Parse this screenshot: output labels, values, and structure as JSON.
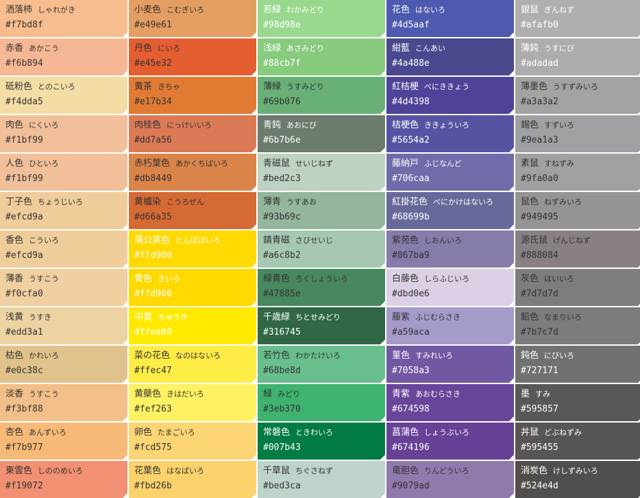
{
  "columns": [
    {
      "items": [
        {
          "name": "洒落柿",
          "reading": "しゃれがき",
          "hex": "#f7bd8f",
          "text": "#333333"
        },
        {
          "name": "赤香",
          "reading": "あかこう",
          "hex": "#f6b894",
          "text": "#333333"
        },
        {
          "name": "砥粉色",
          "reading": "とのこいろ",
          "hex": "#f4dda5",
          "text": "#333333"
        },
        {
          "name": "肉色",
          "reading": "にくいろ",
          "hex": "#f1bf99",
          "text": "#333333"
        },
        {
          "name": "人色",
          "reading": "ひといろ",
          "hex": "#f1bf99",
          "text": "#333333"
        },
        {
          "name": "丁子色",
          "reading": "ちょうじいろ",
          "hex": "#efcd9a",
          "text": "#333333"
        },
        {
          "name": "香色",
          "reading": "こういろ",
          "hex": "#efcd9a",
          "text": "#333333"
        },
        {
          "name": "薄香",
          "reading": "うすこう",
          "hex": "#f0cfa0",
          "text": "#333333"
        },
        {
          "name": "浅黄",
          "reading": "うすき",
          "hex": "#edd3a1",
          "text": "#333333"
        },
        {
          "name": "枯色",
          "reading": "かれいろ",
          "hex": "#e0c38c",
          "text": "#333333"
        },
        {
          "name": "淡香",
          "reading": "うすこう",
          "hex": "#f3bf88",
          "text": "#333333"
        },
        {
          "name": "杏色",
          "reading": "あんずいろ",
          "hex": "#f7b977",
          "text": "#333333"
        },
        {
          "name": "東雲色",
          "reading": "しののめいろ",
          "hex": "#f19072",
          "text": "#333333"
        }
      ]
    },
    {
      "items": [
        {
          "name": "小麦色",
          "reading": "こむぎいろ",
          "hex": "#e49e61",
          "text": "#333333"
        },
        {
          "name": "丹色",
          "reading": "にいろ",
          "hex": "#e45e32",
          "text": "#333333"
        },
        {
          "name": "黄茶",
          "reading": "きちゃ",
          "hex": "#e17b34",
          "text": "#333333"
        },
        {
          "name": "肉桂色",
          "reading": "にっけいいろ",
          "hex": "#dd7a56",
          "text": "#333333"
        },
        {
          "name": "赤朽葉色",
          "reading": "あかくちばいろ",
          "hex": "#db8449",
          "text": "#333333"
        },
        {
          "name": "黄櫨染",
          "reading": "こうろぜん",
          "hex": "#d66a35",
          "text": "#333333"
        },
        {
          "name": "蒲公英色",
          "reading": "たんぽぽいろ",
          "hex": "#ffd900",
          "text": "#ffffff"
        },
        {
          "name": "黄色",
          "reading": "きいろ",
          "hex": "#ffd900",
          "text": "#ffffff"
        },
        {
          "name": "中黄",
          "reading": "ちゅうき",
          "hex": "#ffea00",
          "text": "#ffffff"
        },
        {
          "name": "菜の花色",
          "reading": "なのはないろ",
          "hex": "#ffec47",
          "text": "#333333"
        },
        {
          "name": "黄蘗色",
          "reading": "きはだいろ",
          "hex": "#fef263",
          "text": "#333333"
        },
        {
          "name": "卵色",
          "reading": "たまごいろ",
          "hex": "#fcd575",
          "text": "#333333"
        },
        {
          "name": "花葉色",
          "reading": "はなばいろ",
          "hex": "#fbd26b",
          "text": "#333333"
        }
      ]
    },
    {
      "items": [
        {
          "name": "若緑",
          "reading": "わかみどり",
          "hex": "#98d98e",
          "text": "#ffffff"
        },
        {
          "name": "浅緑",
          "reading": "あさみどり",
          "hex": "#88cb7f",
          "text": "#ffffff"
        },
        {
          "name": "薄緑",
          "reading": "うすみどり",
          "hex": "#69b076",
          "text": "#333333"
        },
        {
          "name": "青鈍",
          "reading": "あおにび",
          "hex": "#6b7b6e",
          "text": "#ffffff"
        },
        {
          "name": "青磁鼠",
          "reading": "せいじねず",
          "hex": "#bed2c3",
          "text": "#333333"
        },
        {
          "name": "薄青",
          "reading": "うすあお",
          "hex": "#93b69c",
          "text": "#333333"
        },
        {
          "name": "錆青磁",
          "reading": "さびせいじ",
          "hex": "#a6c8b2",
          "text": "#333333"
        },
        {
          "name": "緑青色",
          "reading": "ろくしょういろ",
          "hex": "#47885e",
          "text": "#333333"
        },
        {
          "name": "千歳緑",
          "reading": "ちとせみどり",
          "hex": "#316745",
          "text": "#ffffff"
        },
        {
          "name": "若竹色",
          "reading": "わかたけいろ",
          "hex": "#68be8d",
          "text": "#333333"
        },
        {
          "name": "緑",
          "reading": "みどり",
          "hex": "#3eb370",
          "text": "#333333"
        },
        {
          "name": "常磐色",
          "reading": "ときわいろ",
          "hex": "#007b43",
          "text": "#ffffff"
        },
        {
          "name": "千草鼠",
          "reading": "ちぐさねず",
          "hex": "#bed3ca",
          "text": "#333333"
        }
      ]
    },
    {
      "items": [
        {
          "name": "花色",
          "reading": "はないろ",
          "hex": "#4d5aaf",
          "text": "#ffffff"
        },
        {
          "name": "紺藍",
          "reading": "こんあい",
          "hex": "#4a488e",
          "text": "#ffffff"
        },
        {
          "name": "紅桔梗",
          "reading": "べにききょう",
          "hex": "#4d4398",
          "text": "#ffffff"
        },
        {
          "name": "桔梗色",
          "reading": "ききょういろ",
          "hex": "#5654a2",
          "text": "#ffffff"
        },
        {
          "name": "藤納戸",
          "reading": "ふじなんど",
          "hex": "#706caa",
          "text": "#ffffff"
        },
        {
          "name": "紅掛花色",
          "reading": "べにかけはないろ",
          "hex": "#68699b",
          "text": "#ffffff"
        },
        {
          "name": "紫苑色",
          "reading": "しおんいろ",
          "hex": "#867ba9",
          "text": "#333333"
        },
        {
          "name": "白藤色",
          "reading": "しらふじいろ",
          "hex": "#dbd0e6",
          "text": "#333333"
        },
        {
          "name": "藤紫",
          "reading": "ふじむらさき",
          "hex": "#a59aca",
          "text": "#333333"
        },
        {
          "name": "菫色",
          "reading": "すみれいろ",
          "hex": "#7058a3",
          "text": "#ffffff"
        },
        {
          "name": "青紫",
          "reading": "あおむらさき",
          "hex": "#674598",
          "text": "#ffffff"
        },
        {
          "name": "菖蒲色",
          "reading": "しょうぶいろ",
          "hex": "#674196",
          "text": "#ffffff"
        },
        {
          "name": "竜胆色",
          "reading": "りんどういろ",
          "hex": "#9079ad",
          "text": "#333333"
        }
      ]
    },
    {
      "items": [
        {
          "name": "銀鼠",
          "reading": "ぎんねず",
          "hex": "#afafb0",
          "text": "#ffffff"
        },
        {
          "name": "薄鈍",
          "reading": "うすにび",
          "hex": "#adadad",
          "text": "#ffffff"
        },
        {
          "name": "薄墨色",
          "reading": "うすずみいろ",
          "hex": "#a3a3a2",
          "text": "#333333"
        },
        {
          "name": "錫色",
          "reading": "すずいろ",
          "hex": "#9ea1a3",
          "text": "#333333"
        },
        {
          "name": "素鼠",
          "reading": "すねずみ",
          "hex": "#9fa0a0",
          "text": "#333333"
        },
        {
          "name": "鼠色",
          "reading": "ねずみいろ",
          "hex": "#949495",
          "text": "#333333"
        },
        {
          "name": "源氏鼠",
          "reading": "げんじねず",
          "hex": "#888084",
          "text": "#333333"
        },
        {
          "name": "灰色",
          "reading": "はいいろ",
          "hex": "#7d7d7d",
          "text": "#333333"
        },
        {
          "name": "鉛色",
          "reading": "なまりいろ",
          "hex": "#7b7c7d",
          "text": "#333333"
        },
        {
          "name": "鈍色",
          "reading": "にびいろ",
          "hex": "#727171",
          "text": "#ffffff"
        },
        {
          "name": "墨",
          "reading": "すみ",
          "hex": "#595857",
          "text": "#ffffff"
        },
        {
          "name": "丼鼠",
          "reading": "どぶねずみ",
          "hex": "#595455",
          "text": "#ffffff"
        },
        {
          "name": "消炭色",
          "reading": "けしずみいろ",
          "hex": "#524e4d",
          "text": "#ffffff"
        }
      ]
    }
  ]
}
